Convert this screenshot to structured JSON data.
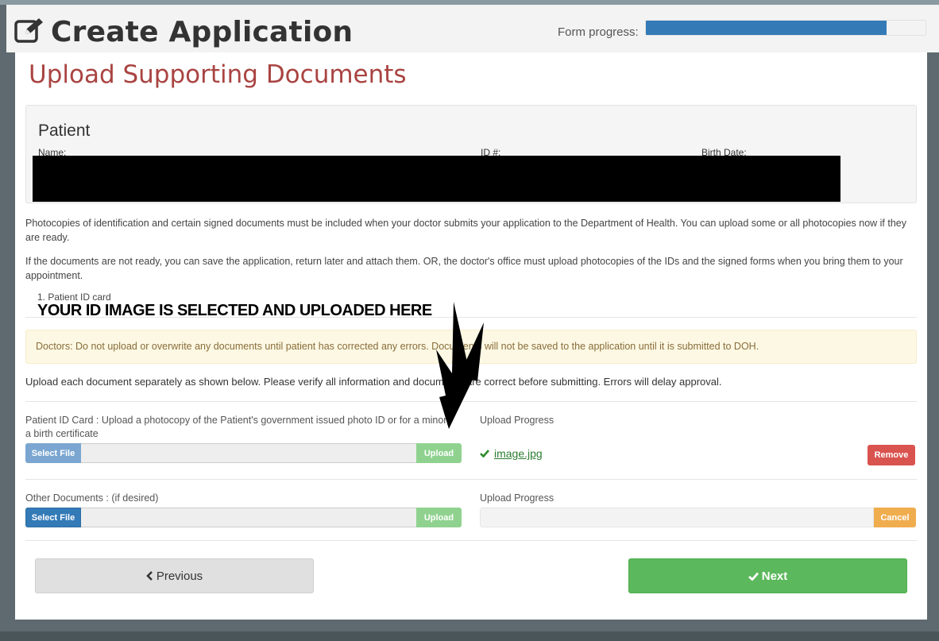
{
  "header": {
    "title": "Create Application",
    "progress_label": "Form progress:",
    "progress_fraction": 0.86,
    "icon": "edit-icon",
    "accent_color": "#337ab7"
  },
  "section": {
    "title": "Upload Supporting Documents",
    "title_color": "#a94442"
  },
  "patient": {
    "heading": "Patient",
    "name_label": "Name:",
    "id_label": "ID #:",
    "birth_label": "Birth Date:"
  },
  "paragraphs": {
    "p1": "Photocopies of identification and certain signed documents must be included when your doctor submits your application to the Department of Health. You can upload some or all photocopies now if they are ready.",
    "p2": "If the documents are not ready, you can save the application, return later and attach them. OR, the doctor's office must upload photocopies of the IDs and the signed forms when you bring them to your appointment."
  },
  "doc_list": {
    "item1": "1.  Patient ID card"
  },
  "annotation": "YOUR ID IMAGE IS SELECTED AND UPLOADED HERE",
  "warning": "Doctors: Do not upload or overwrite any documents until patient has corrected any errors. Documents will not be saved to the application until it is submitted to DOH.",
  "instructions": "Upload each document separately as shown below. Please verify all information and documents are correct before submitting. Errors will delay approval.",
  "uploads": {
    "id_card": {
      "label": "Patient ID Card : Upload a photocopy of the Patient's government issued photo ID or for a minor, a birth certificate",
      "select_label": "Select File",
      "upload_label": "Upload",
      "progress_label": "Upload Progress",
      "file_name": "image.jpg",
      "remove_label": "Remove"
    },
    "other": {
      "label": "Other Documents : (if desired)",
      "select_label": "Select File",
      "upload_label": "Upload",
      "progress_label": "Upload Progress",
      "cancel_label": "Cancel"
    }
  },
  "nav": {
    "previous_label": "Previous",
    "next_label": "Next"
  }
}
